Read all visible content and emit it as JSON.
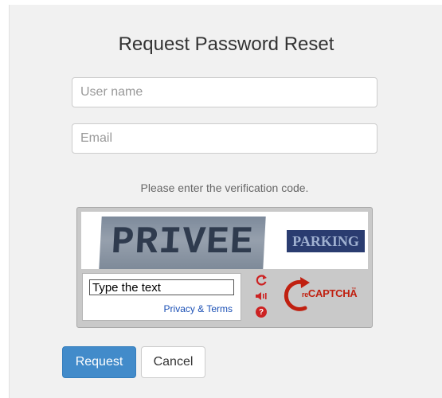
{
  "form": {
    "title": "Request Password Reset",
    "username_placeholder": "User name",
    "email_placeholder": "Email",
    "hint": "Please enter the verification code."
  },
  "captcha": {
    "word1": "PRIVEE",
    "word2": "PARKING",
    "input_placeholder": "Type the text",
    "privacy_link": "Privacy & Terms",
    "logo_prefix": "re",
    "logo_main": "CAPTCHA",
    "logo_tm": "™",
    "icons": [
      "refresh-icon",
      "audio-icon",
      "help-icon"
    ],
    "accent_color": "#c02010"
  },
  "buttons": {
    "request": "Request",
    "cancel": "Cancel"
  },
  "colors": {
    "primary": "#428bca",
    "panel_bg": "#f1f1f1"
  }
}
